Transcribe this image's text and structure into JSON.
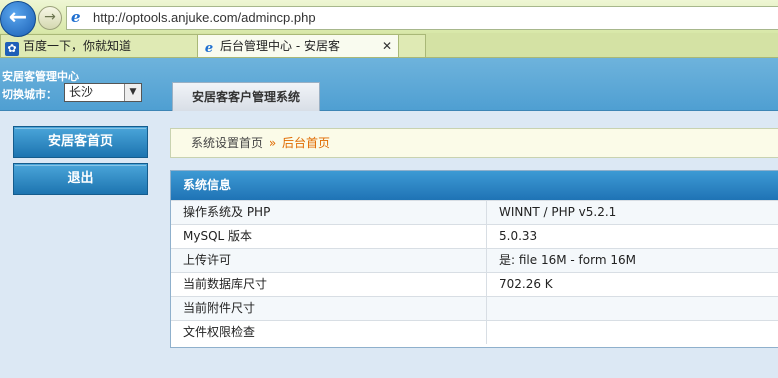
{
  "browser": {
    "url": "http://optools.anjuke.com/admincp.php",
    "tabs": [
      {
        "label": "百度一下，你就知道"
      },
      {
        "label": "后台管理中心 - 安居客",
        "close": "✕"
      }
    ]
  },
  "header": {
    "site_title": "安居客管理中心",
    "city_label": "切换城市：",
    "city_selected": "长沙",
    "main_tab": "安居客客户管理系统"
  },
  "sidebar": {
    "items": [
      {
        "label": "安居客首页"
      },
      {
        "label": "退出"
      }
    ]
  },
  "breadcrumb": {
    "home": "系统设置首页",
    "separator": "»",
    "current": "后台首页"
  },
  "info": {
    "title": "系统信息",
    "rows": [
      {
        "key": "操作系统及 PHP",
        "value": "WINNT / PHP v5.2.1"
      },
      {
        "key": "MySQL 版本",
        "value": "5.0.33"
      },
      {
        "key": "上传许可",
        "value": "是: file 16M - form 16M"
      },
      {
        "key": "当前数据库尺寸",
        "value": "702.26 K"
      },
      {
        "key": "当前附件尺寸",
        "value": ""
      },
      {
        "key": "文件权限检查",
        "value": ""
      }
    ]
  },
  "colors": {
    "header_blue": "#5aa8d6",
    "button_blue": "#1d74b0",
    "breadcrumb_accent": "#e06a00"
  }
}
